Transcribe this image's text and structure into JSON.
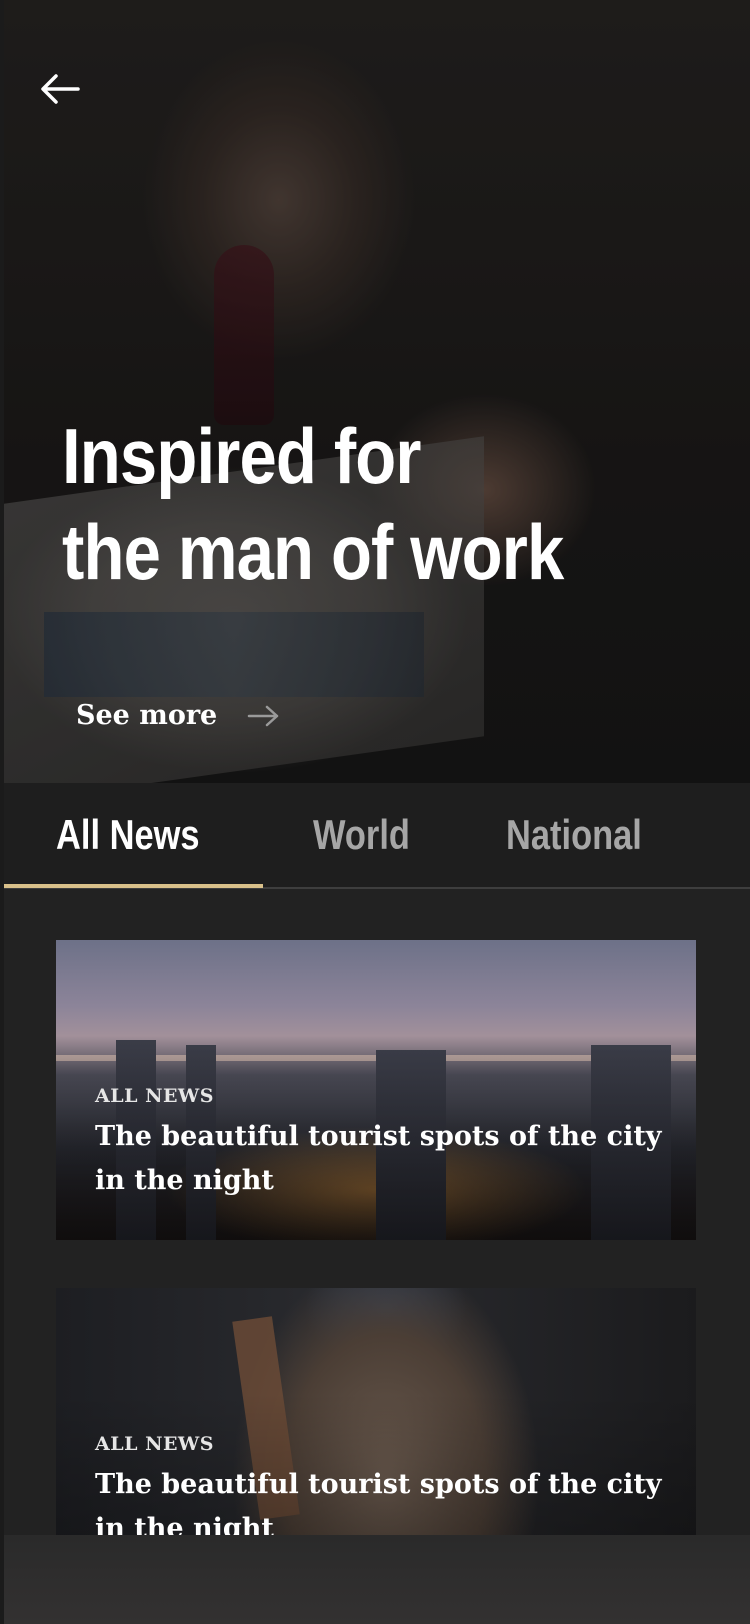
{
  "hero": {
    "title_line1": "Inspired for",
    "title_line2": "the man of work",
    "see_more_label": "See more",
    "back_icon": "arrow-left-icon",
    "see_more_icon": "arrow-right-icon"
  },
  "tabs": [
    {
      "label": "All News",
      "active": true
    },
    {
      "label": "World",
      "active": false
    },
    {
      "label": "National",
      "active": false
    }
  ],
  "articles": [
    {
      "category": "ALL NEWS",
      "title": "The beautiful tourist spots of the city in the night"
    },
    {
      "category": "ALL NEWS",
      "title": "The beautiful tourist spots of the city in the night"
    }
  ],
  "colors": {
    "background": "#222222",
    "accent": "#d9c08a",
    "text": "#ffffff",
    "inactive_tab": "#a6a6a6"
  }
}
